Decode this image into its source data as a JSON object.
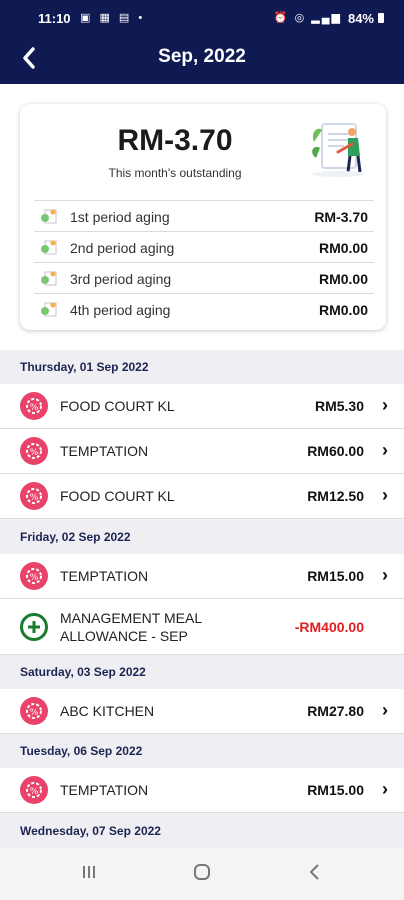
{
  "status_bar": {
    "time": "11:10",
    "battery": "84%"
  },
  "header": {
    "back_icon": "chevron-left-icon",
    "title": "Sep, 2022"
  },
  "summary": {
    "amount": "RM-3.70",
    "subtitle": "This month's outstanding",
    "aging": [
      {
        "label": "1st period aging",
        "value": "RM-3.70"
      },
      {
        "label": "2nd period aging",
        "value": "RM0.00"
      },
      {
        "label": "3rd period aging",
        "value": "RM0.00"
      },
      {
        "label": "4th period aging",
        "value": "RM0.00"
      }
    ]
  },
  "transactions": {
    "groups": [
      {
        "date": "Thursday, 01 Sep 2022",
        "items": [
          {
            "name": "FOOD COURT KL",
            "amount": "RM5.30"
          },
          {
            "name": "TEMPTATION",
            "amount": "RM60.00"
          },
          {
            "name": "FOOD COURT KL",
            "amount": "RM12.50"
          }
        ]
      },
      {
        "date": "Friday, 02 Sep 2022",
        "items": [
          {
            "name": "TEMPTATION",
            "amount": "RM15.00"
          },
          {
            "name": "MANAGEMENT MEAL ALLOWANCE - SEP",
            "amount": "-RM400.00"
          }
        ]
      },
      {
        "date": "Saturday, 03 Sep 2022",
        "items": [
          {
            "name": "ABC KITCHEN",
            "amount": "RM27.80"
          }
        ]
      },
      {
        "date": "Tuesday, 06 Sep 2022",
        "items": [
          {
            "name": "TEMPTATION",
            "amount": "RM15.00"
          }
        ]
      },
      {
        "date": "Wednesday, 07 Sep 2022",
        "items": []
      }
    ]
  },
  "colors": {
    "header_bg": "#101a52",
    "debit_icon": "#e9436b",
    "credit_icon": "#1a7a2e",
    "credit_amount": "#e02020"
  }
}
